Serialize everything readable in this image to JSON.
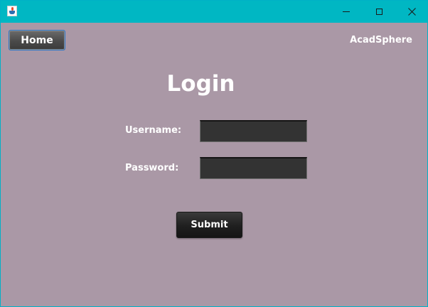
{
  "window": {
    "title": "",
    "controls": {
      "minimize_icon": "minimize-icon",
      "maximize_icon": "maximize-icon",
      "close_icon": "close-icon"
    },
    "titlebar_color": "#00b7c3",
    "background_color": "#aa98a6"
  },
  "header": {
    "home_label": "Home",
    "brand": "AcadSphere"
  },
  "login": {
    "title": "Login",
    "username_label": "Username:",
    "username_value": "",
    "password_label": "Password:",
    "password_value": "",
    "submit_label": "Submit"
  }
}
